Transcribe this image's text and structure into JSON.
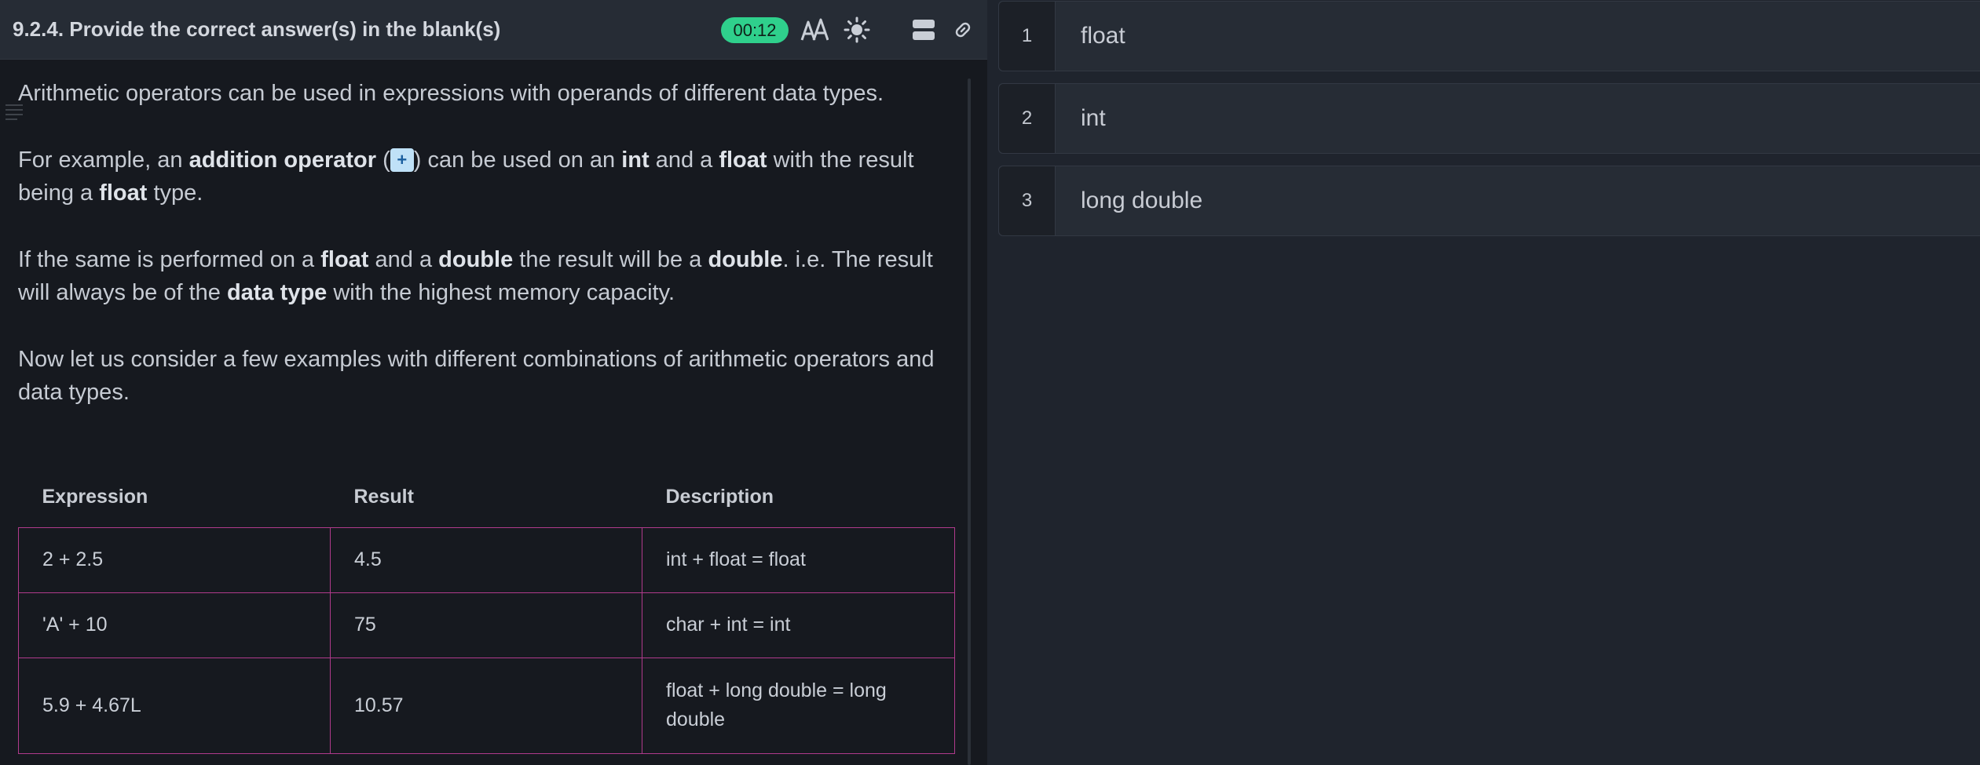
{
  "header": {
    "title": "9.2.4. Provide the correct answer(s) in the blank(s)",
    "timer": "00:12"
  },
  "icons": {
    "font_size": "font-size-icon",
    "theme": "sun-icon",
    "layout": "layout-icon",
    "link": "link-icon"
  },
  "content": {
    "p1": "Arithmetic operators can be used in expressions with operands of different data types.",
    "p2": {
      "t1": "For example, an ",
      "b1": "addition operator",
      "t2": " (",
      "chip": "+",
      "t3": ") can be used on an ",
      "b2": "int",
      "t4": " and a ",
      "b3": "float",
      "t5": " with the result being a ",
      "b4": "float",
      "t6": " type."
    },
    "p3": {
      "t1": "If the same is performed on a ",
      "b1": "float",
      "t2": " and a ",
      "b2": "double",
      "t3": " the result will be a ",
      "b3": "double",
      "t4": ". i.e. The result will always be of the ",
      "b4": "data type",
      "t5": " with the highest memory capacity."
    },
    "p4": "Now let us consider a few examples with different combinations of arithmetic operators and data types."
  },
  "table": {
    "headers": [
      "Expression",
      "Result",
      "Description"
    ],
    "rows": [
      [
        "2 + 2.5",
        "4.5",
        "int + float = float"
      ],
      [
        "'A' + 10",
        "75",
        "char + int = int"
      ],
      [
        "5.9 + 4.67L",
        "10.57",
        "float + long double = long double"
      ]
    ]
  },
  "answers": [
    {
      "num": "1",
      "text": "float"
    },
    {
      "num": "2",
      "text": "int"
    },
    {
      "num": "3",
      "text": "long double"
    }
  ],
  "colors": {
    "timer_bg": "#2fd08c",
    "table_border": "#b03a8c",
    "chip_bg": "#bfe1f7"
  }
}
